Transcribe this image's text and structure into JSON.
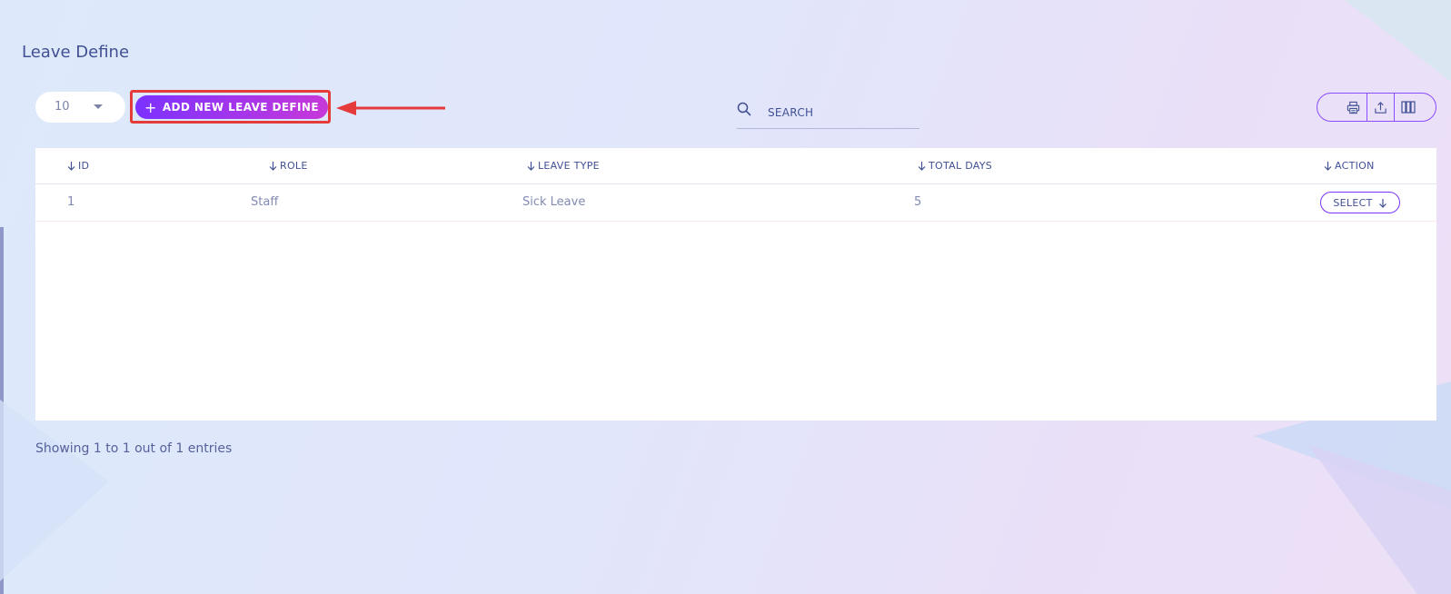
{
  "page": {
    "title": "Leave Define"
  },
  "toolbar": {
    "per_page_value": "10",
    "add_button_label": "ADD NEW LEAVE DEFINE",
    "add_button_icon": "plus-icon",
    "search_placeholder": "SEARCH",
    "tools": [
      {
        "name": "print-icon"
      },
      {
        "name": "export-icon"
      },
      {
        "name": "columns-icon"
      }
    ]
  },
  "table": {
    "columns": [
      "ID",
      "ROLE",
      "LEAVE TYPE",
      "TOTAL DAYS",
      "ACTION"
    ],
    "rows": [
      {
        "id": "1",
        "role": "Staff",
        "leave_type": "Sick Leave",
        "total_days": "5",
        "action_label": "SELECT"
      }
    ]
  },
  "footer": {
    "entries_info": "Showing 1 to 1 out of 1 entries"
  },
  "colors": {
    "accent": "#7c32ff",
    "accent_end": "#c738d8",
    "text_primary": "#415094",
    "annotation_red": "#e53b3b"
  }
}
